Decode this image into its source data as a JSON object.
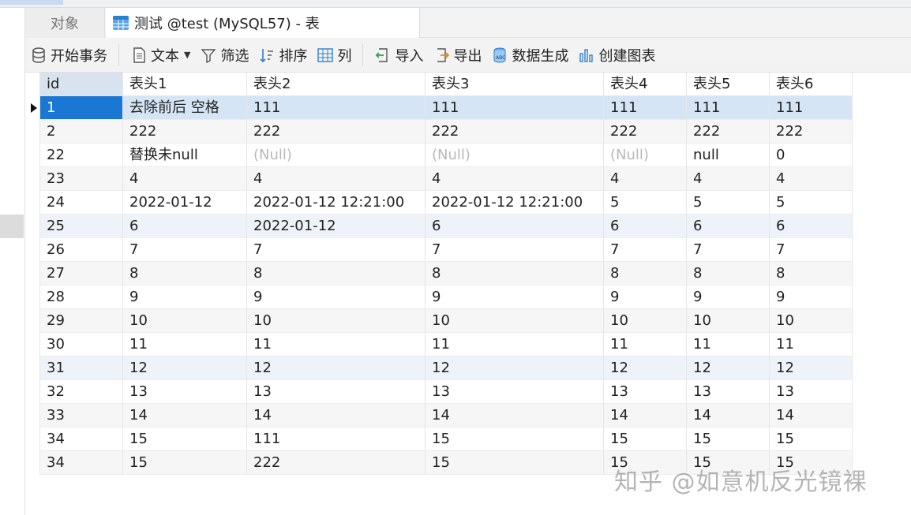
{
  "tabs": {
    "objects_label": "对象",
    "table_tab_label": "测试 @test (MySQL57) - 表"
  },
  "toolbar": {
    "begin_transaction": "开始事务",
    "text": "文本",
    "filter": "筛选",
    "sort": "排序",
    "columns": "列",
    "import": "导入",
    "export": "导出",
    "data_generation": "数据生成",
    "create_chart": "创建图表"
  },
  "table": {
    "headers": [
      "id",
      "表头1",
      "表头2",
      "表头3",
      "表头4",
      "表头5",
      "表头6"
    ],
    "rows": [
      {
        "cells": [
          "1",
          "去除前后 空格",
          "111",
          "111",
          "111",
          "111",
          "111"
        ],
        "nulls": [],
        "selected": true
      },
      {
        "cells": [
          "2",
          "222",
          "222",
          "222",
          "222",
          "222",
          "222"
        ],
        "nulls": []
      },
      {
        "cells": [
          "22",
          "替换未null",
          "(Null)",
          "(Null)",
          "(Null)",
          "null",
          "0"
        ],
        "nulls": [
          2,
          3,
          4
        ]
      },
      {
        "cells": [
          "23",
          "4",
          "4",
          "4",
          "4",
          "4",
          "4"
        ],
        "nulls": []
      },
      {
        "cells": [
          "24",
          "2022-01-12",
          "2022-01-12 12:21:00",
          "2022-01-12 12:21:00",
          "5",
          "5",
          "5"
        ],
        "nulls": []
      },
      {
        "cells": [
          "25",
          "6",
          "2022-01-12",
          "6",
          "6",
          "6",
          "6"
        ],
        "nulls": [],
        "alt": true
      },
      {
        "cells": [
          "26",
          "7",
          "7",
          "7",
          "7",
          "7",
          "7"
        ],
        "nulls": []
      },
      {
        "cells": [
          "27",
          "8",
          "8",
          "8",
          "8",
          "8",
          "8"
        ],
        "nulls": []
      },
      {
        "cells": [
          "28",
          "9",
          "9",
          "9",
          "9",
          "9",
          "9"
        ],
        "nulls": []
      },
      {
        "cells": [
          "29",
          "10",
          "10",
          "10",
          "10",
          "10",
          "10"
        ],
        "nulls": []
      },
      {
        "cells": [
          "30",
          "11",
          "11",
          "11",
          "11",
          "11",
          "11"
        ],
        "nulls": []
      },
      {
        "cells": [
          "31",
          "12",
          "12",
          "12",
          "12",
          "12",
          "12"
        ],
        "nulls": [],
        "alt": true
      },
      {
        "cells": [
          "32",
          "13",
          "13",
          "13",
          "13",
          "13",
          "13"
        ],
        "nulls": []
      },
      {
        "cells": [
          "33",
          "14",
          "14",
          "14",
          "14",
          "14",
          "14"
        ],
        "nulls": []
      },
      {
        "cells": [
          "34",
          "15",
          "111",
          "15",
          "15",
          "15",
          "15"
        ],
        "nulls": []
      },
      {
        "cells": [
          "34",
          "15",
          "222",
          "15",
          "15",
          "15",
          "15"
        ],
        "nulls": []
      }
    ]
  },
  "watermark": "知乎 @如意机反光镜裸",
  "colors": {
    "selected_id_bg": "#1a78d4",
    "selected_row_bg": "#d5e5f6",
    "null_text": "#b9b9b9"
  }
}
